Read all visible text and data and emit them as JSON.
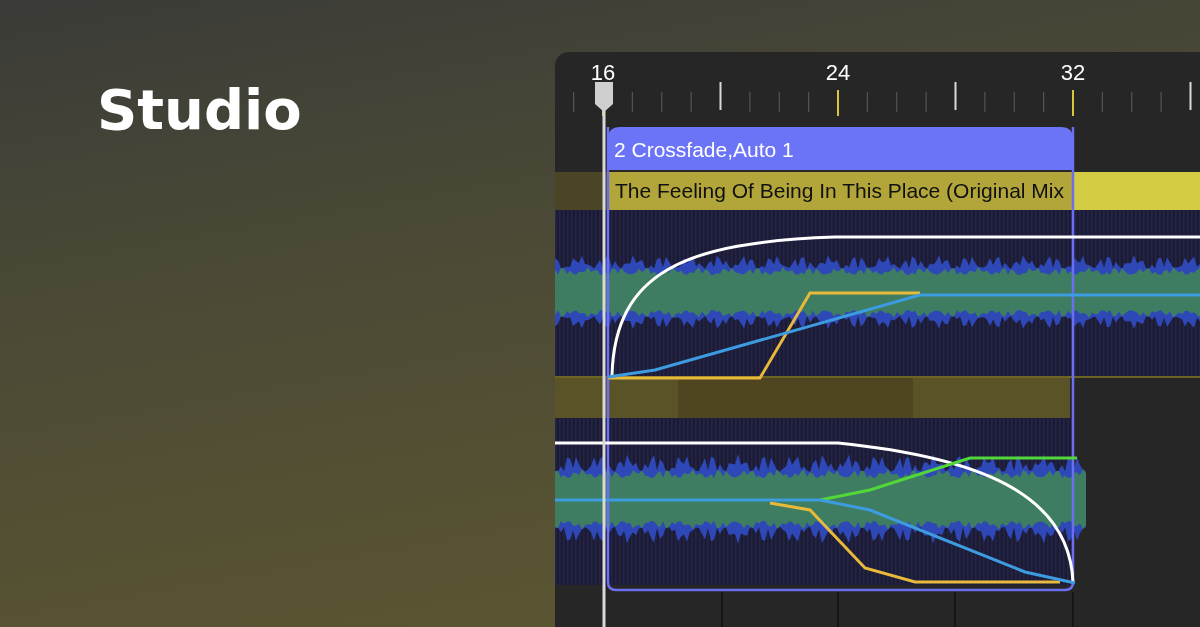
{
  "hero": {
    "title": "Studio"
  },
  "ruler": {
    "labels": [
      "16",
      "24",
      "32"
    ]
  },
  "clip": {
    "title": "2 Crossfade,Auto 1"
  },
  "region": {
    "name": "The Feeling Of Being In This Place (Original Mix"
  }
}
